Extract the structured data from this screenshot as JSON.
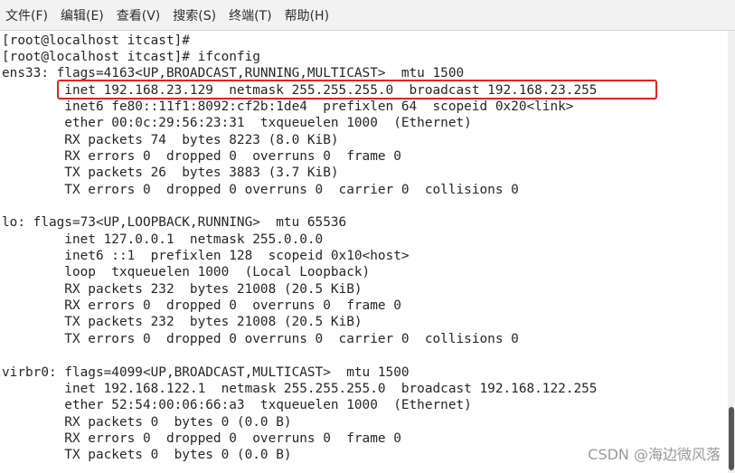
{
  "menubar": {
    "items": [
      {
        "label": "文件(F)"
      },
      {
        "label": "编辑(E)"
      },
      {
        "label": "查看(V)"
      },
      {
        "label": "搜索(S)"
      },
      {
        "label": "终端(T)"
      },
      {
        "label": "帮助(H)"
      }
    ]
  },
  "terminal": {
    "lines": [
      "[root@localhost itcast]# ",
      "[root@localhost itcast]# ifconfig",
      "ens33: flags=4163<UP,BROADCAST,RUNNING,MULTICAST>  mtu 1500",
      "        inet 192.168.23.129  netmask 255.255.255.0  broadcast 192.168.23.255",
      "        inet6 fe80::11f1:8092:cf2b:1de4  prefixlen 64  scopeid 0x20<link>",
      "        ether 00:0c:29:56:23:31  txqueuelen 1000  (Ethernet)",
      "        RX packets 74  bytes 8223 (8.0 KiB)",
      "        RX errors 0  dropped 0  overruns 0  frame 0",
      "        TX packets 26  bytes 3883 (3.7 KiB)",
      "        TX errors 0  dropped 0 overruns 0  carrier 0  collisions 0",
      "",
      "lo: flags=73<UP,LOOPBACK,RUNNING>  mtu 65536",
      "        inet 127.0.0.1  netmask 255.0.0.0",
      "        inet6 ::1  prefixlen 128  scopeid 0x10<host>",
      "        loop  txqueuelen 1000  (Local Loopback)",
      "        RX packets 232  bytes 21008 (20.5 KiB)",
      "        RX errors 0  dropped 0  overruns 0  frame 0",
      "        TX packets 232  bytes 21008 (20.5 KiB)",
      "        TX errors 0  dropped 0 overruns 0  carrier 0  collisions 0",
      "",
      "virbr0: flags=4099<UP,BROADCAST,MULTICAST>  mtu 1500",
      "        inet 192.168.122.1  netmask 255.255.255.0  broadcast 192.168.122.255",
      "        ether 52:54:00:06:66:a3  txqueuelen 1000  (Ethernet)",
      "        RX packets 0  bytes 0 (0.0 B)",
      "        RX errors 0  dropped 0  overruns 0  frame 0",
      "        TX packets 0  bytes 0 (0.0 B)"
    ]
  },
  "watermark": "CSDN @海边微风落",
  "colors": {
    "highlight": "#e8231f",
    "text": "#262626",
    "menubar_bg": "#f2f2f2"
  }
}
